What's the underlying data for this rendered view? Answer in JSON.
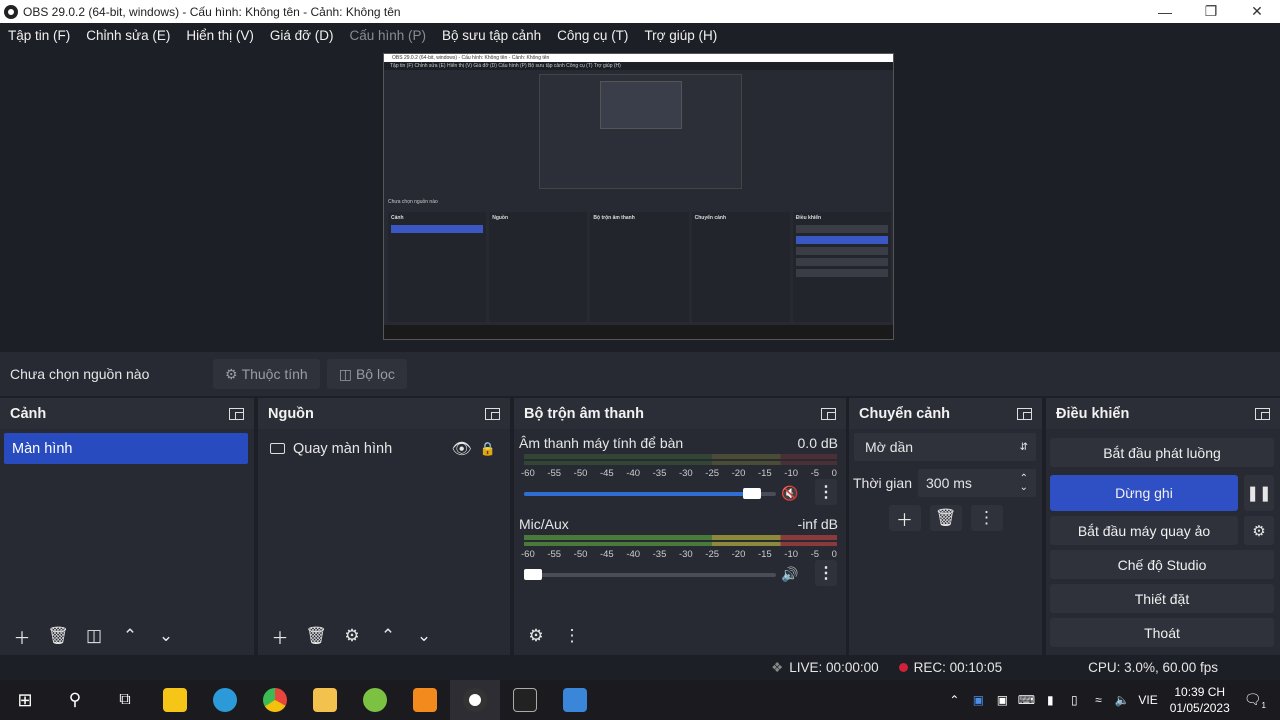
{
  "window": {
    "title": "OBS 29.0.2 (64-bit, windows) - Cấu hình: Không tên - Cảnh: Không tên"
  },
  "menu": [
    "Tập tin (F)",
    "Chỉnh sửa (E)",
    "Hiển thị (V)",
    "Giá đỡ (D)",
    "Cấu hình (P)",
    "Bộ sưu tập cảnh",
    "Công cụ (T)",
    "Trợ giúp (H)"
  ],
  "source_bar": {
    "label": "Chưa chọn nguồn nào",
    "properties": "Thuộc tính",
    "filters": "Bộ lọc"
  },
  "scenes": {
    "title": "Cảnh",
    "items": [
      "Màn hình"
    ]
  },
  "sources": {
    "title": "Nguồn",
    "items": [
      "Quay màn hình"
    ]
  },
  "mixer": {
    "title": "Bộ trộn âm thanh",
    "ticks": [
      "-60",
      "-55",
      "-50",
      "-45",
      "-40",
      "-35",
      "-30",
      "-25",
      "-20",
      "-15",
      "-10",
      "-5",
      "0"
    ],
    "channels": [
      {
        "name": "Âm thanh máy tính để bàn",
        "level": "0.0 dB",
        "volume": 0.97,
        "muted": true
      },
      {
        "name": "Mic/Aux",
        "level": "-inf dB",
        "volume": 0.0,
        "muted": false
      }
    ]
  },
  "transitions": {
    "title": "Chuyển cảnh",
    "selected": "Mờ dần",
    "duration_label": "Thời gian",
    "duration": "300 ms"
  },
  "controls": {
    "title": "Điều khiển",
    "start_stream": "Bắt đầu phát luồng",
    "stop_record": "Dừng ghi",
    "virtual_cam": "Bắt đầu máy quay ảo",
    "studio": "Chế độ Studio",
    "settings": "Thiết đặt",
    "exit": "Thoát"
  },
  "status": {
    "live": "LIVE: 00:00:00",
    "rec": "REC: 00:10:05",
    "cpu": "CPU: 3.0%, 60.00 fps"
  },
  "taskbar": {
    "lang": "VIE",
    "time": "10:39 CH",
    "date": "01/05/2023",
    "notifications": "1",
    "apps": [
      {
        "name": "start-icon",
        "color": "#ffffff"
      },
      {
        "name": "search-icon",
        "color": "#ffffff"
      },
      {
        "name": "task-view-icon",
        "color": "#ffffff"
      },
      {
        "name": "sticky-notes-icon",
        "color": "#f5c518"
      },
      {
        "name": "edge-icon",
        "color": "#2c9ad8"
      },
      {
        "name": "chrome-icon",
        "color": "#e8453c"
      },
      {
        "name": "file-explorer-icon",
        "color": "#f2c14e"
      },
      {
        "name": "app-green-icon",
        "color": "#7cc242"
      },
      {
        "name": "sublime-icon",
        "color": "#f28a1e"
      },
      {
        "name": "obs-icon",
        "color": "#ffffff"
      },
      {
        "name": "terminal-icon",
        "color": "#222222"
      },
      {
        "name": "app-blue-icon",
        "color": "#3a86d8"
      }
    ]
  },
  "preview_thumb": {
    "menu": "Tập tin (F)   Chỉnh sửa (E)   Hiển thị (V)   Giá đỡ (D)   Cấu hình (P)   Bộ sưu tập cảnh   Công cụ (T)   Trợ giúp (H)",
    "title": "OBS 29.0.2 (64-bit, windows) - Cấu hình: Không tên - Cảnh: Không tên",
    "srclabel": "Chưa chọn nguồn nào",
    "docks": [
      "Cảnh",
      "Nguồn",
      "Bộ trộn âm thanh",
      "Chuyển cảnh",
      "Điều khiển"
    ]
  }
}
